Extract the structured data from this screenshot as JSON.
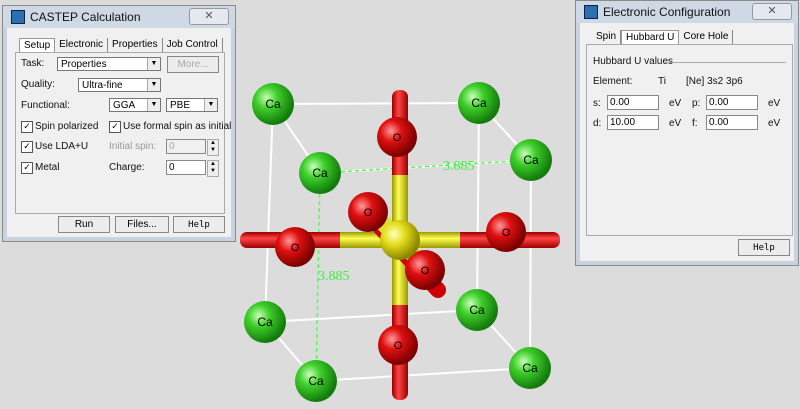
{
  "scene": {
    "distance_top": "3.885",
    "distance_side": "3.885",
    "atom_ca": "Ca",
    "atom_o": "O"
  },
  "castep": {
    "title": "CASTEP Calculation",
    "close": "✕",
    "tabs": [
      "Setup",
      "Electronic",
      "Properties",
      "Job Control"
    ],
    "task_label": "Task:",
    "task_value": "Properties",
    "more_button": "More...",
    "quality_label": "Quality:",
    "quality_value": "Ultra-fine",
    "functional_label": "Functional:",
    "functional_value": "GGA",
    "functional_sub": "PBE",
    "spin_polarized": "Spin polarized",
    "use_formal_spin": "Use formal spin as initial",
    "use_lda_u": "Use LDA+U",
    "initial_spin_label": "Initial spin:",
    "initial_spin_value": "0",
    "metal": "Metal",
    "charge_label": "Charge:",
    "charge_value": "0",
    "run": "Run",
    "files": "Files...",
    "help": "Help"
  },
  "elec": {
    "title": "Electronic Configuration",
    "close": "✕",
    "tabs": [
      "Spin",
      "Hubbard U",
      "Core Hole"
    ],
    "group": "Hubbard U values",
    "element_label": "Element:",
    "element": "Ti",
    "config": "[Ne] 3s2 3p6",
    "s_label": "s:",
    "s_value": "0.00",
    "p_label": "p:",
    "p_value": "0.00",
    "d_label": "d:",
    "d_value": "10.00",
    "f_label": "f:",
    "f_value": "0.00",
    "unit": "eV",
    "help": "Help"
  }
}
